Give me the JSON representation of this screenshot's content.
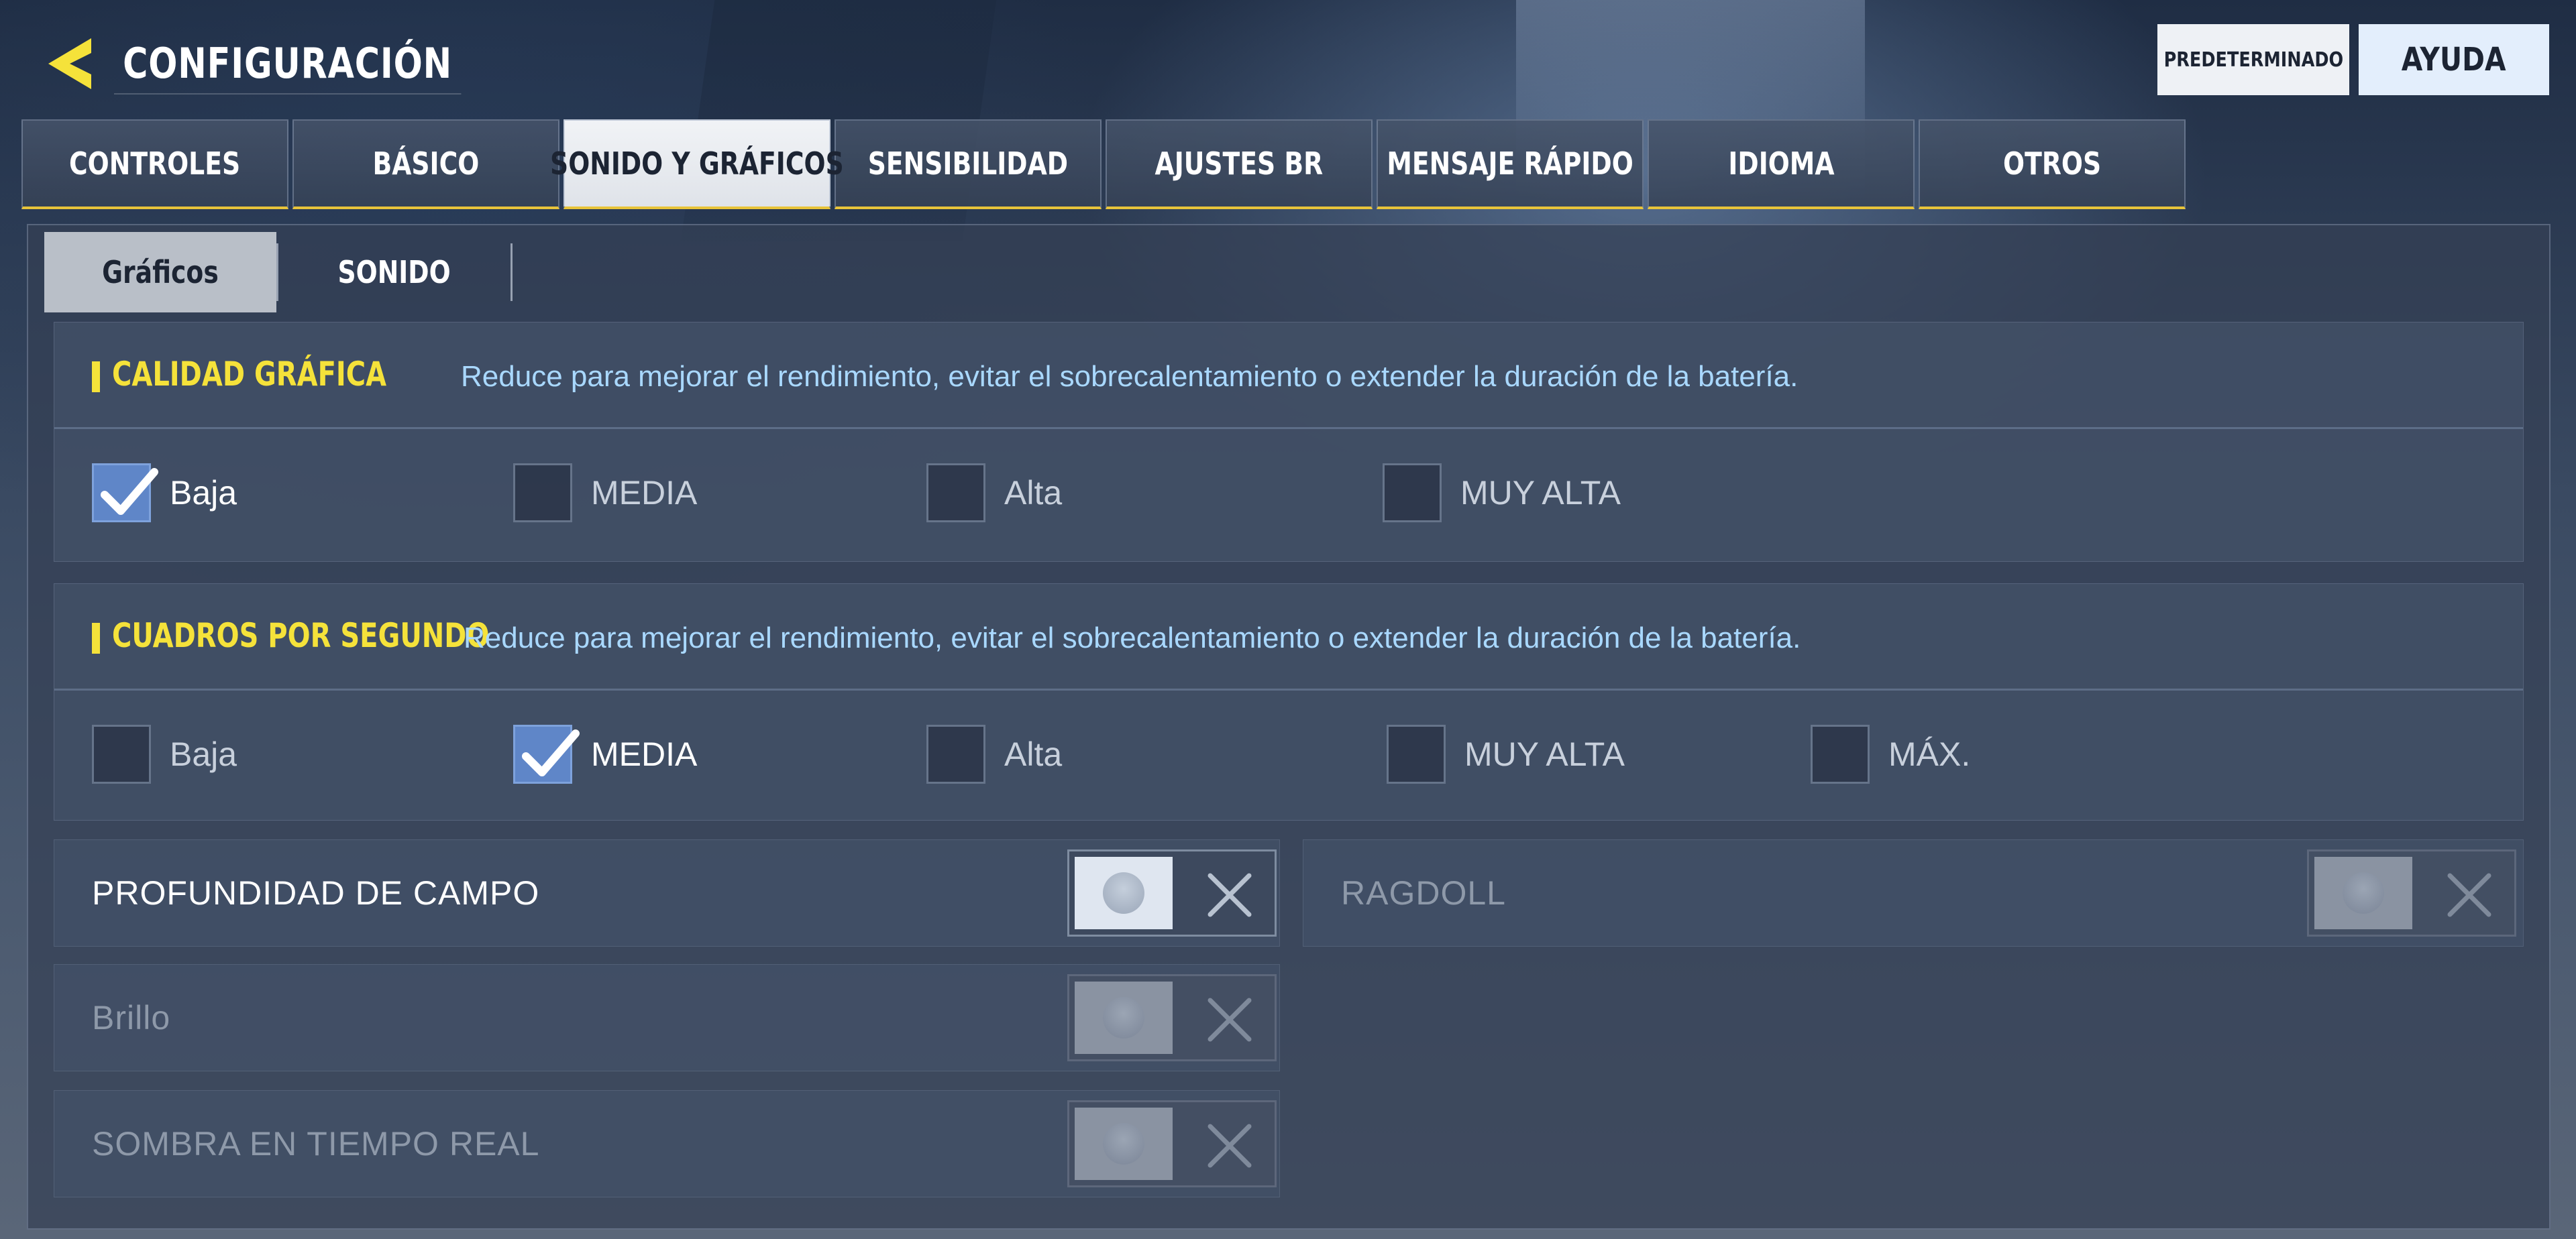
{
  "header": {
    "title": "CONFIGURACIÓN",
    "back_icon": "chevron-left-icon",
    "accent": "#f5e23a"
  },
  "top_buttons": {
    "default_label": "PREDETERMINADO",
    "help_label": "AYUDA"
  },
  "tabs": [
    {
      "label": "CONTROLES",
      "active": false
    },
    {
      "label": "BÁSICO",
      "active": false
    },
    {
      "label": "SONIDO Y GRÁFICOS",
      "active": true
    },
    {
      "label": "SENSIBILIDAD",
      "active": false
    },
    {
      "label": "AJUSTES BR",
      "active": false
    },
    {
      "label": "MENSAJE RÁPIDO",
      "active": false
    },
    {
      "label": "IDIOMA",
      "active": false
    },
    {
      "label": "OTROS",
      "active": false
    }
  ],
  "subtabs": [
    {
      "label": "Gráficos",
      "active": true
    },
    {
      "label": "SONIDO",
      "active": false
    }
  ],
  "quality": {
    "title": "CALIDAD GRÁFICA",
    "description": "Reduce para mejorar el rendimiento, evitar el sobrecalentamiento o extender la duración de la batería.",
    "options": [
      {
        "label": "Baja",
        "checked": true
      },
      {
        "label": "MEDIA",
        "checked": false
      },
      {
        "label": "Alta",
        "checked": false
      },
      {
        "label": "MUY ALTA",
        "checked": false
      }
    ]
  },
  "fps": {
    "title": "CUADROS POR SEGUNDO",
    "description": "Reduce para mejorar el rendimiento, evitar el sobrecalentamiento o extender la duración de la batería.",
    "options": [
      {
        "label": "Baja",
        "checked": false
      },
      {
        "label": "MEDIA",
        "checked": true
      },
      {
        "label": "Alta",
        "checked": false
      },
      {
        "label": "MUY ALTA",
        "checked": false
      },
      {
        "label": "MÁX.",
        "checked": false
      }
    ]
  },
  "toggles": {
    "depth_of_field": {
      "label": "PROFUNDIDAD DE CAMPO",
      "on": false,
      "enabled": true
    },
    "ragdoll": {
      "label": "RAGDOLL",
      "on": false,
      "enabled": false
    },
    "brightness": {
      "label": "Brillo",
      "on": false,
      "enabled": false
    },
    "realtime_shadow": {
      "label": "SOMBRA EN TIEMPO REAL",
      "on": false,
      "enabled": false
    }
  }
}
